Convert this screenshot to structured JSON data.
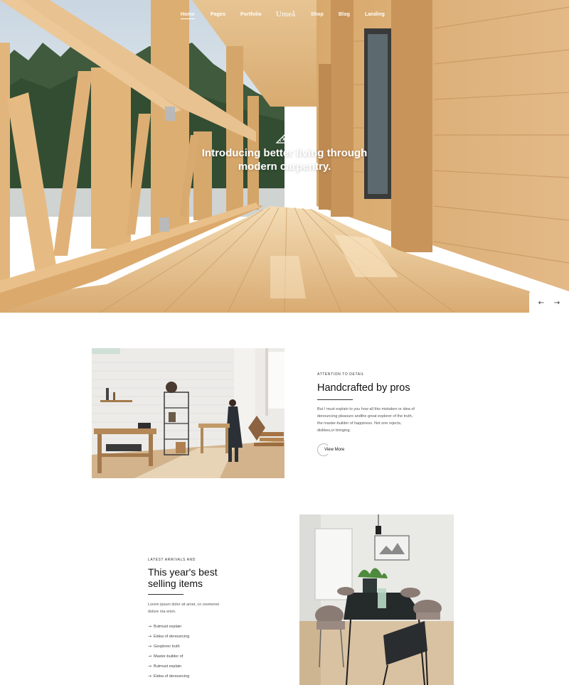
{
  "nav": {
    "items": [
      {
        "label": "Home",
        "active": true
      },
      {
        "label": "Pages"
      },
      {
        "label": "Portfolio"
      },
      {
        "label": "Shop"
      },
      {
        "label": "Blog"
      },
      {
        "label": "Landing"
      }
    ],
    "brand": "Umeå"
  },
  "hero": {
    "title_line1": "Introducing better living through",
    "title_line2": "modern carpentry.",
    "logo_icon": "set-square-icon",
    "prev_icon": "arrow-left-icon",
    "next_icon": "arrow-right-icon",
    "prev_glyph": "←",
    "next_glyph": "→"
  },
  "feature": {
    "eyebrow": "ATTENTION TO DETAIL",
    "title": "Handcrafted by pros",
    "body": "But I must explain to you how all this mistaken or idea of denouncing pleasure andthe great explorer of the truth, the master-builder of happiness. Not one rejects, dislikes,or bringing.",
    "cta": "View More"
  },
  "arrivals": {
    "eyebrow": "LATEST ARRIVALS AND",
    "title_line1": "This year's best",
    "title_line2": "selling items",
    "body": "Lorem ipsum dolor sit amet, co oremenet dolore ma enim.",
    "list": [
      "Butmust explain",
      "Eidea of denouncing",
      "Gexplorer truth",
      "Master-builder of",
      "Butmust explain",
      "Eidea of denouncing"
    ],
    "arrow_glyph": "→"
  },
  "colors": {
    "wood_light": "#e8c89a",
    "wood_mid": "#d4a36a",
    "wood_dark": "#b98450",
    "sky": "#dfe7ee",
    "forest": "#3d5a3a"
  }
}
